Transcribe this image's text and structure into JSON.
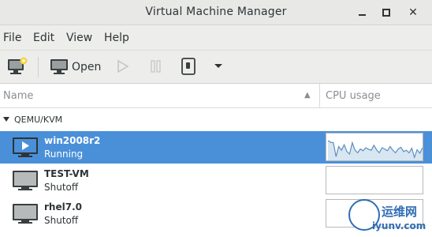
{
  "window": {
    "title": "Virtual Machine Manager"
  },
  "menubar": {
    "items": [
      "File",
      "Edit",
      "View",
      "Help"
    ]
  },
  "toolbar": {
    "open_label": "Open"
  },
  "columns": {
    "name": "Name",
    "cpu": "CPU usage"
  },
  "group": {
    "label": "QEMU/KVM"
  },
  "vms": [
    {
      "name": "win2008r2",
      "status": "Running",
      "selected": true,
      "cpu_usage": [
        0.78,
        0.72,
        0.7,
        0.15,
        0.55,
        0.4,
        0.62,
        0.35,
        0.25,
        0.7,
        0.4,
        0.3,
        0.45,
        0.38,
        0.5,
        0.44,
        0.4,
        0.6,
        0.42,
        0.3,
        0.5,
        0.45,
        0.38,
        0.55,
        0.4,
        0.3,
        0.45,
        0.52,
        0.35,
        0.4,
        0.3,
        0.48,
        0.12,
        0.42,
        0.28,
        0.5
      ]
    },
    {
      "name": "TEST-VM",
      "status": "Shutoff",
      "selected": false,
      "cpu_usage": []
    },
    {
      "name": "rhel7.0",
      "status": "Shutoff",
      "selected": false,
      "cpu_usage": []
    }
  ],
  "watermark": {
    "line1": "运维网",
    "line2": "iyunv.com"
  },
  "colors": {
    "selection": "#4a90d9",
    "graph_line": "#5a8fc0",
    "graph_fill": "#d8e6f2"
  }
}
